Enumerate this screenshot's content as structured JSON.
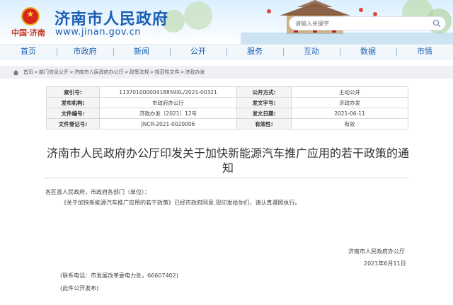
{
  "header": {
    "seal_text": "中国·济南",
    "site_title": "济南市人民政府",
    "site_url": "www.jinan.gov.cn",
    "search_placeholder": "请输入关键字"
  },
  "nav": [
    {
      "label": "首页"
    },
    {
      "label": "市政府"
    },
    {
      "label": "新闻"
    },
    {
      "label": "公开"
    },
    {
      "label": "服务"
    },
    {
      "label": "互动"
    },
    {
      "label": "数据"
    },
    {
      "label": "市情"
    }
  ],
  "breadcrumb": [
    "首页",
    "部门信息公开",
    "济南市人民政府办公厅",
    "政策法规",
    "规范性文件",
    "济政办发"
  ],
  "meta": {
    "rows": [
      {
        "l1": "索引号:",
        "v1": "11370100000418859XL/2021-00321",
        "l2": "公开方式:",
        "v2": "主动公开"
      },
      {
        "l1": "发布机构:",
        "v1": "市政府办公厅",
        "l2": "发文字号:",
        "v2": "济政办发"
      },
      {
        "l1": "文件编号:",
        "v1": "济政办发〔2021〕12号",
        "l2": "发文日期:",
        "v2": "2021-06-11"
      },
      {
        "l1": "文件登记号:",
        "v1": "JNCR-2021-0020006",
        "l2": "有效性:",
        "v2": "有效"
      }
    ]
  },
  "doc": {
    "title_line1": "济南市人民政府办公厅印发关于加快新能源汽车推广应用的若干政策的通",
    "title_line2": "知",
    "salutation": "各区县人民政府，市政府各部门（单位）：",
    "body": "《关于加快新能源汽车推广应用的若干政策》已经市政府同意,现印发给你们，请认真遵照执行。",
    "issuer": "济南市人民政府办公厅",
    "date": "2021年6月11日",
    "contact": "(联系电话：市发展改革委电力处，66607402)",
    "publish_note": "(此件公开发布)"
  },
  "colors": {
    "brand_blue": "#1a5fb4",
    "seal_red": "#d9261c"
  }
}
